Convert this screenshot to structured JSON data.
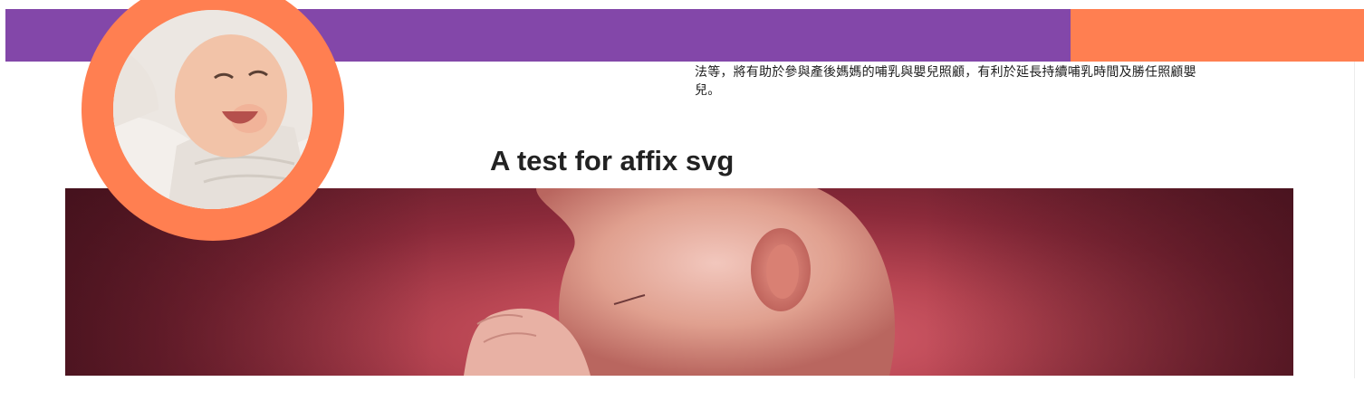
{
  "header": {
    "primary_color": "#8347a9",
    "accent_color": "#ff7f51"
  },
  "avatar": {
    "icon": "baby-photo",
    "ring_color": "#ff7f51"
  },
  "article": {
    "paragraph_line1": "法等，將有助於參與產後媽媽的哺乳與嬰兒照顧，有利於延長持續哺乳時間及勝任照顧嬰",
    "paragraph_line2": "兒。",
    "heading": "A test for affix svg",
    "hero_image": "fetus-in-womb-illustration"
  }
}
